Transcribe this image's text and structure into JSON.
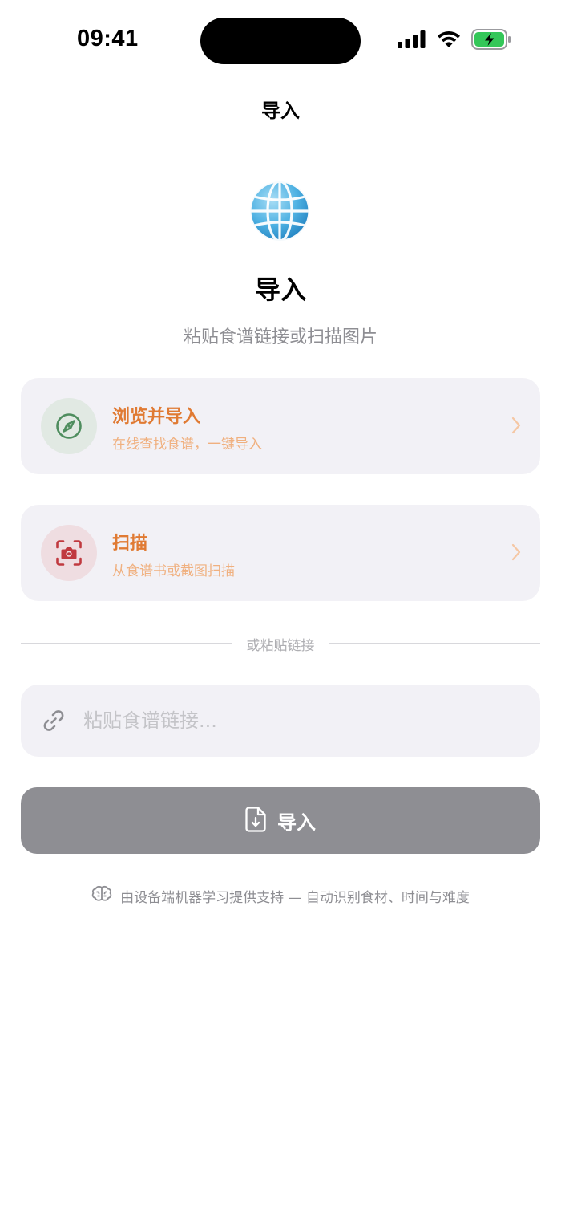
{
  "status_bar": {
    "time": "09:41",
    "icons": [
      "cellular-signal-icon",
      "wifi-icon",
      "battery-charging-icon"
    ]
  },
  "nav": {
    "title": "导入"
  },
  "hero": {
    "icon": "globe-icon",
    "title": "导入",
    "subtitle": "粘贴食谱链接或扫描图片"
  },
  "options": [
    {
      "icon": "compass-icon",
      "title": "浏览并导入",
      "subtitle": "在线查找食谱，一键导入"
    },
    {
      "icon": "camera-scan-icon",
      "title": "扫描",
      "subtitle": "从食谱书或截图扫描"
    }
  ],
  "divider": {
    "label": "或粘贴链接"
  },
  "url_input": {
    "value": "",
    "placeholder": "粘贴食谱链接..."
  },
  "import_button": {
    "label": "导入",
    "icon": "document-download-icon"
  },
  "footer": {
    "icon": "brain-icon",
    "text": "由设备端机器学习提供支持 — 自动识别食材、时间与难度"
  },
  "colors": {
    "accent": "#E07A33",
    "accent_light": "#F0B07F",
    "browse_icon": "#4E8D5E",
    "scan_icon": "#C0393F",
    "card_background": "#F2F1F6",
    "button_disabled": "#8E8E93",
    "secondary_text": "#8E8E93"
  }
}
